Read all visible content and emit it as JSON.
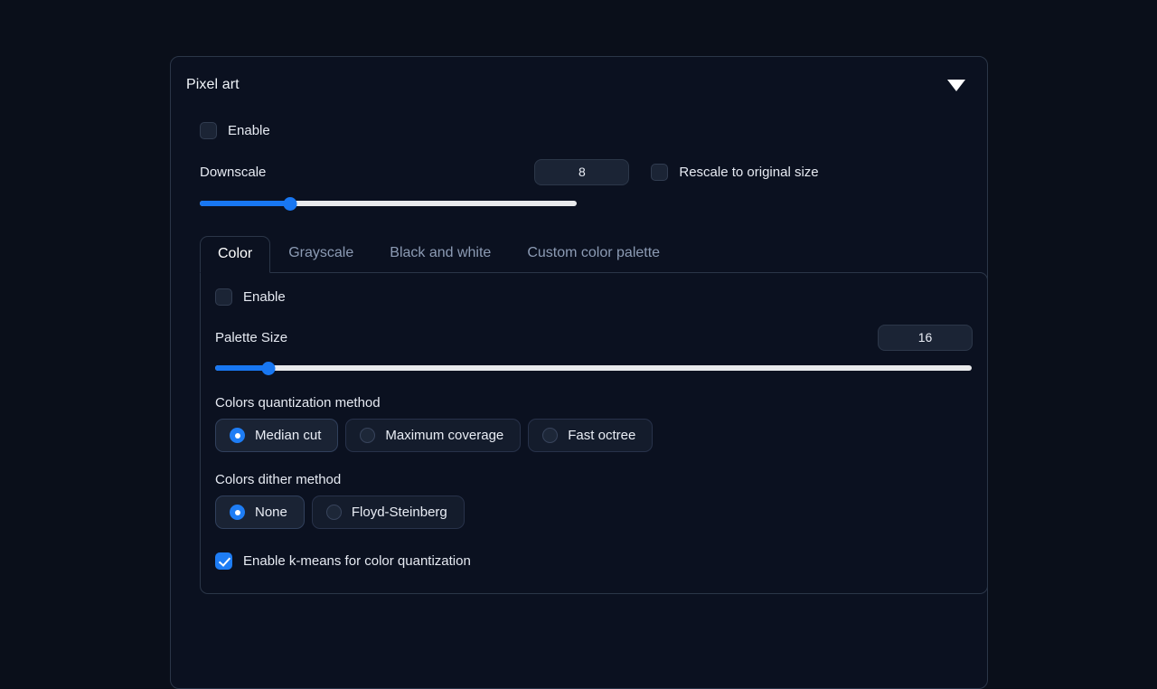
{
  "panel": {
    "title": "Pixel art",
    "collapse_icon": "caret-down-icon",
    "enable": {
      "label": "Enable",
      "checked": false
    },
    "downscale": {
      "label": "Downscale",
      "value": "8",
      "slider_percent": 24,
      "rescale": {
        "label": "Rescale to original size",
        "checked": false
      }
    },
    "tabs": [
      {
        "label": "Color",
        "active": true
      },
      {
        "label": "Grayscale",
        "active": false
      },
      {
        "label": "Black and white",
        "active": false
      },
      {
        "label": "Custom color palette",
        "active": false
      }
    ],
    "color_tab": {
      "enable": {
        "label": "Enable",
        "checked": false
      },
      "palette_size": {
        "label": "Palette Size",
        "value": "16",
        "slider_percent": 7
      },
      "quantization": {
        "label": "Colors quantization method",
        "options": [
          {
            "label": "Median cut",
            "selected": true
          },
          {
            "label": "Maximum coverage",
            "selected": false
          },
          {
            "label": "Fast octree",
            "selected": false
          }
        ]
      },
      "dither": {
        "label": "Colors dither method",
        "options": [
          {
            "label": "None",
            "selected": true
          },
          {
            "label": "Floyd-Steinberg",
            "selected": false
          }
        ]
      },
      "kmeans": {
        "label": "Enable k-means for color quantization",
        "checked": true
      }
    }
  },
  "colors": {
    "page_background": "#0a0f1a",
    "card_background": "#0b1120",
    "border": "#2b3648",
    "accent": "#1e7df5",
    "slider_fill": "#1877f2",
    "slider_track": "#e9eaec",
    "text": "#e6eaf2",
    "muted_text": "#8c9bb4"
  }
}
